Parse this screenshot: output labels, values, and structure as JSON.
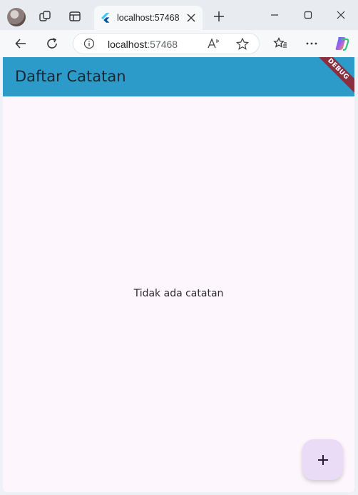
{
  "browser": {
    "tab_title": "localhost:57468",
    "url_host": "localhost",
    "url_port": ":57468"
  },
  "app": {
    "title": "Daftar Catatan",
    "debug_banner": "DEBUG",
    "empty_message": "Tidak ada catatan",
    "fab_icon": "add-icon"
  },
  "colors": {
    "appbar": "#2d9bc9",
    "background": "#fdf7fd",
    "fab": "#eadcf7",
    "debug_ribbon": "#8a2f3f"
  }
}
